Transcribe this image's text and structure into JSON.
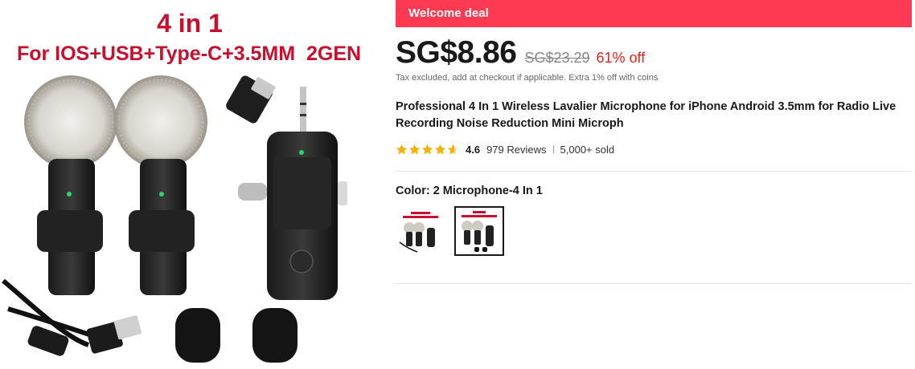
{
  "image": {
    "headline": "4 in 1",
    "subheadline": "For IOS+USB+Type-C+3.5MM  2GEN",
    "headline_color": "#c8102e"
  },
  "deal": {
    "banner": "Welcome deal",
    "color": "#fd3a52"
  },
  "price": {
    "current": "SG$8.86",
    "original": "SG$23.29",
    "discount": "61% off",
    "discount_color": "#e1251b"
  },
  "tax_note": "Tax excluded, add at checkout if applicable. Extra 1% off with coins",
  "product": {
    "title": "Professional 4 In 1 Wireless Lavalier Microphone for iPhone Android 3.5mm for Radio Live Recording Noise Reduction Mini Microph"
  },
  "rating": {
    "value": "4.6",
    "stars": 4.6,
    "reviews": "979 Reviews",
    "sold": "5,000+ sold",
    "star_color": "#f2b10b"
  },
  "variant": {
    "label": "Color: 2 Microphone-4 In 1",
    "options": [
      {
        "icon": "variant-thumbnail-1",
        "selected": false
      },
      {
        "icon": "variant-thumbnail-2",
        "selected": true
      }
    ]
  }
}
